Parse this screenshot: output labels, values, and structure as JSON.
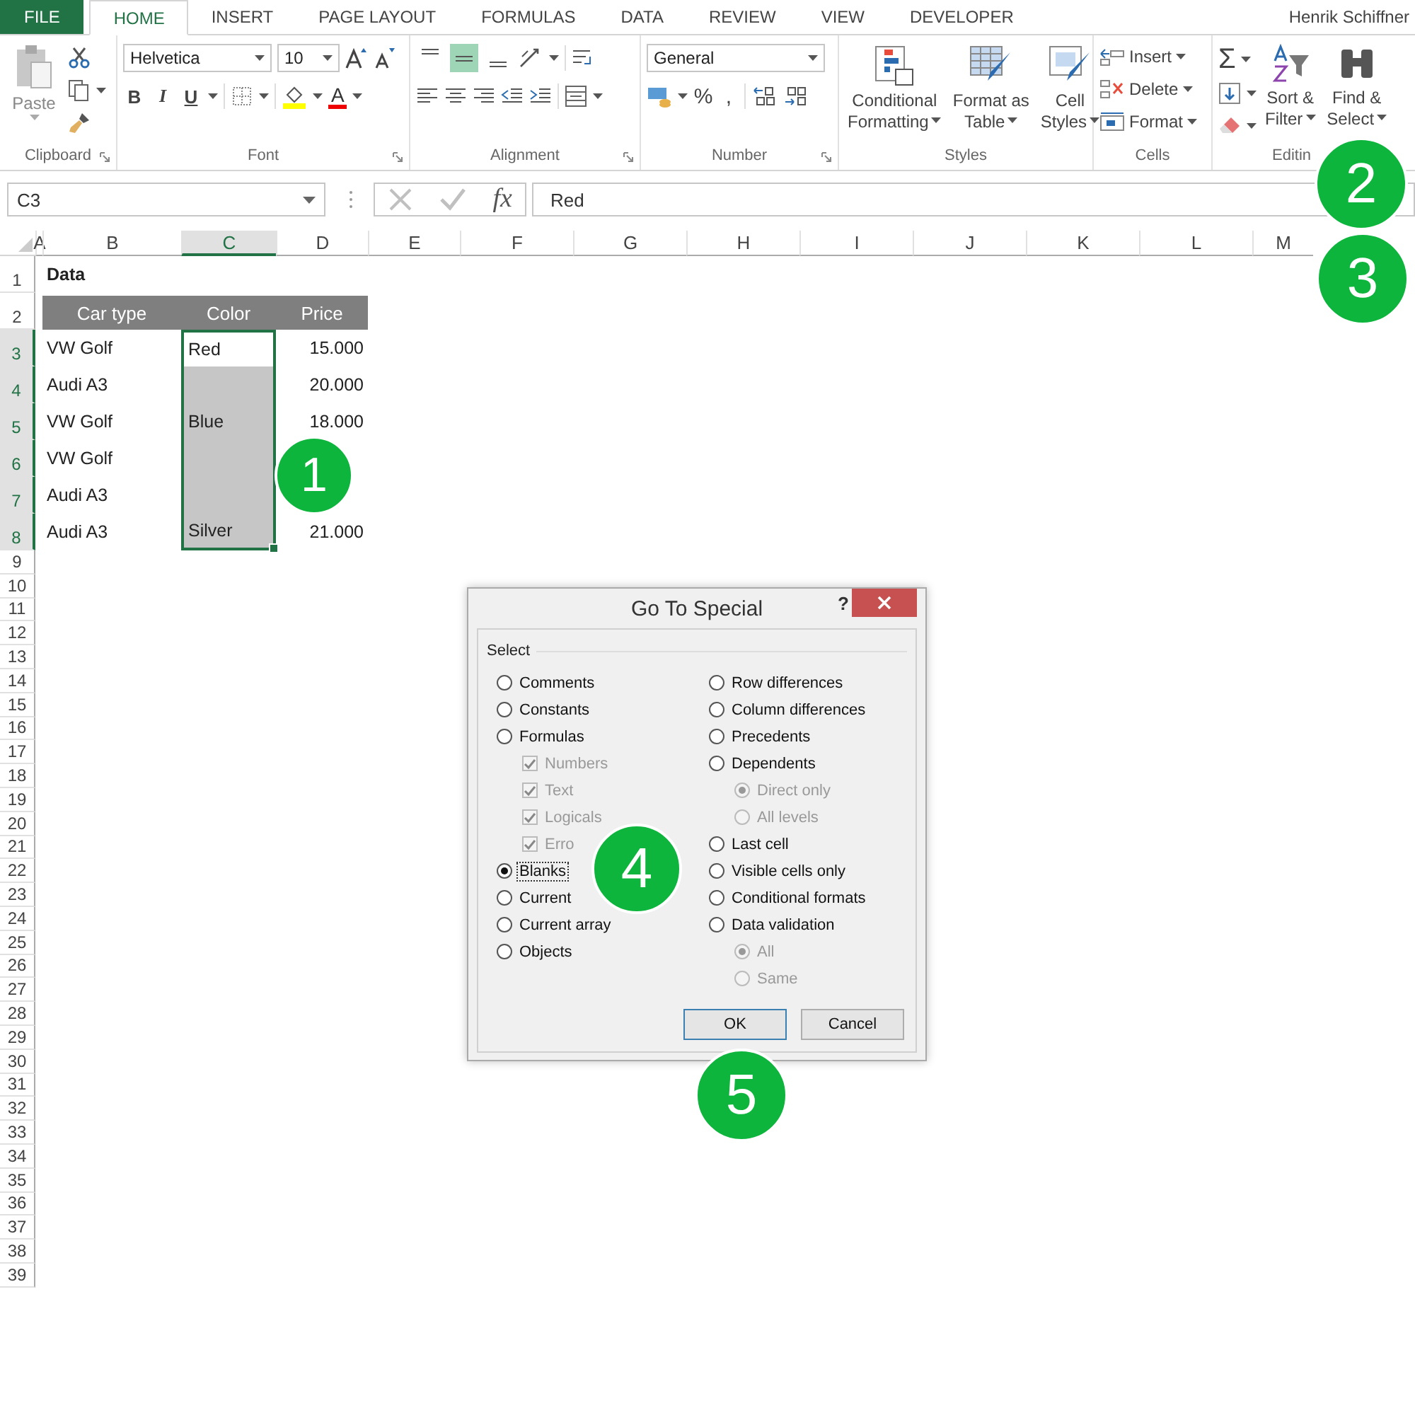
{
  "ribbon_tabs": [
    {
      "label": "FILE",
      "kind": "file",
      "selected": false
    },
    {
      "label": "HOME",
      "kind": "tab",
      "selected": true
    },
    {
      "label": "INSERT",
      "kind": "tab",
      "selected": false
    },
    {
      "label": "PAGE LAYOUT",
      "kind": "tab",
      "selected": false
    },
    {
      "label": "FORMULAS",
      "kind": "tab",
      "selected": false
    },
    {
      "label": "DATA",
      "kind": "tab",
      "selected": false
    },
    {
      "label": "REVIEW",
      "kind": "tab",
      "selected": false
    },
    {
      "label": "VIEW",
      "kind": "tab",
      "selected": false
    },
    {
      "label": "DEVELOPER",
      "kind": "tab",
      "selected": false
    }
  ],
  "user": "Henrik Schiffner",
  "clipboard": {
    "paste": "Paste",
    "label": "Clipboard"
  },
  "font": {
    "name": "Helvetica",
    "size": "10",
    "style_buttons": [
      "B",
      "I",
      "U"
    ],
    "color_letter": "A",
    "label": "Font"
  },
  "alignment": {
    "vertical_buttons": [
      {
        "selected": false
      },
      {
        "selected": true
      },
      {
        "selected": false
      }
    ],
    "label": "Alignment"
  },
  "number": {
    "format": "General",
    "symbols": [
      "%",
      ","
    ],
    "label": "Number"
  },
  "styles": {
    "buttons": [
      {
        "lines": [
          "Conditional",
          "Formatting"
        ]
      },
      {
        "lines": [
          "Format as",
          "Table"
        ]
      },
      {
        "lines": [
          "Cell",
          "Styles"
        ]
      }
    ],
    "label": "Styles"
  },
  "cells": {
    "buttons": [
      "Insert",
      "Delete",
      "Format"
    ],
    "label": "Cells"
  },
  "editing": {
    "sum": "Σ",
    "buttons": [
      {
        "lines": [
          "Sort &",
          "Filter"
        ]
      },
      {
        "lines": [
          "Find &",
          "Select"
        ]
      }
    ],
    "label": "Editin"
  },
  "formula_bar": {
    "name_box": "C3",
    "fx": "fx",
    "value": "Red"
  },
  "sheet": {
    "columns": [
      {
        "label": "A",
        "selected": false
      },
      {
        "label": "B",
        "selected": false
      },
      {
        "label": "C",
        "selected": true
      },
      {
        "label": "D",
        "selected": false
      },
      {
        "label": "E",
        "selected": false
      },
      {
        "label": "F",
        "selected": false
      },
      {
        "label": "G",
        "selected": false
      },
      {
        "label": "H",
        "selected": false
      },
      {
        "label": "I",
        "selected": false
      },
      {
        "label": "J",
        "selected": false
      },
      {
        "label": "K",
        "selected": false
      },
      {
        "label": "L",
        "selected": false
      },
      {
        "label": "M",
        "selected": false
      }
    ],
    "rows": [
      {
        "number": "1",
        "kind": "title",
        "selected": false,
        "cells": [
          {
            "text": "Data"
          }
        ]
      },
      {
        "number": "2",
        "kind": "header",
        "selected": false,
        "cells": [
          {
            "text": "Car type"
          },
          {
            "text": "Color"
          },
          {
            "text": "Price"
          }
        ]
      },
      {
        "number": "3",
        "kind": "data",
        "selected": true,
        "cells": [
          {
            "text": "VW Golf",
            "selected": false,
            "active": false
          },
          {
            "text": "Red",
            "selected": true,
            "active": true
          },
          {
            "text": "15.000",
            "selected": false,
            "active": false
          }
        ]
      },
      {
        "number": "4",
        "kind": "data",
        "selected": true,
        "cells": [
          {
            "text": "Audi A3",
            "selected": false,
            "active": false
          },
          {
            "selected": true,
            "active": false
          },
          {
            "text": "20.000",
            "selected": false,
            "active": false
          }
        ]
      },
      {
        "number": "5",
        "kind": "data",
        "selected": true,
        "cells": [
          {
            "text": "VW Golf",
            "selected": false,
            "active": false
          },
          {
            "text": "Blue",
            "selected": true,
            "active": false
          },
          {
            "text": "18.000",
            "selected": false,
            "active": false
          }
        ]
      },
      {
        "number": "6",
        "kind": "data",
        "selected": true,
        "cells": [
          {
            "text": "VW Golf",
            "selected": false,
            "active": false
          },
          {
            "selected": true,
            "active": false
          },
          {
            "selected": false,
            "active": false
          }
        ]
      },
      {
        "number": "7",
        "kind": "data",
        "selected": true,
        "cells": [
          {
            "text": "Audi A3",
            "selected": false,
            "active": false
          },
          {
            "selected": true,
            "active": false
          },
          {
            "selected": false,
            "active": false
          }
        ]
      },
      {
        "number": "8",
        "kind": "data",
        "selected": true,
        "cells": [
          {
            "text": "Audi A3",
            "selected": false,
            "active": false
          },
          {
            "text": "Silver",
            "selected": true,
            "active": false
          },
          {
            "text": "21.000",
            "selected": false,
            "active": false
          }
        ]
      },
      {
        "number": "9",
        "kind": "empty",
        "selected": false
      },
      {
        "number": "10",
        "kind": "empty",
        "selected": false
      },
      {
        "number": "11",
        "kind": "empty",
        "selected": false
      },
      {
        "number": "12",
        "kind": "empty",
        "selected": false
      },
      {
        "number": "13",
        "kind": "empty",
        "selected": false
      },
      {
        "number": "14",
        "kind": "empty",
        "selected": false
      },
      {
        "number": "15",
        "kind": "empty",
        "selected": false
      },
      {
        "number": "16",
        "kind": "empty",
        "selected": false
      },
      {
        "number": "17",
        "kind": "empty",
        "selected": false
      },
      {
        "number": "18",
        "kind": "empty",
        "selected": false
      },
      {
        "number": "19",
        "kind": "empty",
        "selected": false
      },
      {
        "number": "20",
        "kind": "empty",
        "selected": false
      },
      {
        "number": "21",
        "kind": "empty",
        "selected": false
      },
      {
        "number": "22",
        "kind": "empty",
        "selected": false
      },
      {
        "number": "23",
        "kind": "empty",
        "selected": false
      },
      {
        "number": "24",
        "kind": "empty",
        "selected": false
      },
      {
        "number": "25",
        "kind": "empty",
        "selected": false
      },
      {
        "number": "26",
        "kind": "empty",
        "selected": false
      },
      {
        "number": "27",
        "kind": "empty",
        "selected": false
      },
      {
        "number": "28",
        "kind": "empty",
        "selected": false
      },
      {
        "number": "29",
        "kind": "empty",
        "selected": false
      },
      {
        "number": "30",
        "kind": "empty",
        "selected": false
      },
      {
        "number": "31",
        "kind": "empty",
        "selected": false
      },
      {
        "number": "32",
        "kind": "empty",
        "selected": false
      },
      {
        "number": "33",
        "kind": "empty",
        "selected": false
      },
      {
        "number": "34",
        "kind": "empty",
        "selected": false
      },
      {
        "number": "35",
        "kind": "empty",
        "selected": false
      },
      {
        "number": "36",
        "kind": "empty",
        "selected": false
      },
      {
        "number": "37",
        "kind": "empty",
        "selected": false
      },
      {
        "number": "38",
        "kind": "empty",
        "selected": false
      },
      {
        "number": "39",
        "kind": "empty",
        "selected": false
      }
    ]
  },
  "dialog": {
    "title": "Go To Special",
    "help": "?",
    "group": "Select",
    "left": [
      {
        "label": "Comments",
        "kind": "radio",
        "selected": false,
        "disabled": false
      },
      {
        "label": "Constants",
        "kind": "radio",
        "selected": false,
        "disabled": false
      },
      {
        "label": "Formulas",
        "kind": "radio",
        "selected": false,
        "disabled": false,
        "children": [
          {
            "label": "Numbers",
            "kind": "check",
            "checked": true,
            "disabled": true
          },
          {
            "label": "Text",
            "kind": "check",
            "checked": true,
            "disabled": true
          },
          {
            "label": "Logicals",
            "kind": "check",
            "checked": true,
            "disabled": true
          },
          {
            "label": "Erro",
            "kind": "check",
            "checked": true,
            "disabled": true
          }
        ]
      },
      {
        "label": "Blanks",
        "kind": "radio",
        "selected": true,
        "disabled": false
      },
      {
        "label": "Current",
        "kind": "radio",
        "selected": false,
        "disabled": false
      },
      {
        "label": "Current array",
        "kind": "radio",
        "selected": false,
        "disabled": false
      },
      {
        "label": "Objects",
        "kind": "radio",
        "selected": false,
        "disabled": false
      }
    ],
    "right": [
      {
        "label": "Row differences",
        "kind": "radio",
        "selected": false,
        "disabled": false
      },
      {
        "label": "Column differences",
        "kind": "radio",
        "selected": false,
        "disabled": false
      },
      {
        "label": "Precedents",
        "kind": "radio",
        "selected": false,
        "disabled": false
      },
      {
        "label": "Dependents",
        "kind": "radio",
        "selected": false,
        "disabled": false,
        "children": [
          {
            "label": "Direct only",
            "kind": "radio",
            "selected": true,
            "disabled": true
          },
          {
            "label": "All levels",
            "kind": "radio",
            "selected": false,
            "disabled": true
          }
        ]
      },
      {
        "label": "Last cell",
        "kind": "radio",
        "selected": false,
        "disabled": false
      },
      {
        "label": "Visible cells only",
        "kind": "radio",
        "selected": false,
        "disabled": false
      },
      {
        "label": "Conditional formats",
        "kind": "radio",
        "selected": false,
        "disabled": false
      },
      {
        "label": "Data validation",
        "kind": "radio",
        "selected": false,
        "disabled": false,
        "children": [
          {
            "label": "All",
            "kind": "radio",
            "selected": true,
            "disabled": true
          },
          {
            "label": "Same",
            "kind": "radio",
            "selected": false,
            "disabled": true
          }
        ]
      }
    ],
    "buttons": [
      {
        "label": "OK",
        "default": true
      },
      {
        "label": "Cancel",
        "default": false
      }
    ]
  },
  "annotations": [
    {
      "label": "1"
    },
    {
      "label": "2"
    },
    {
      "label": "3"
    },
    {
      "label": "4"
    },
    {
      "label": "5"
    }
  ]
}
